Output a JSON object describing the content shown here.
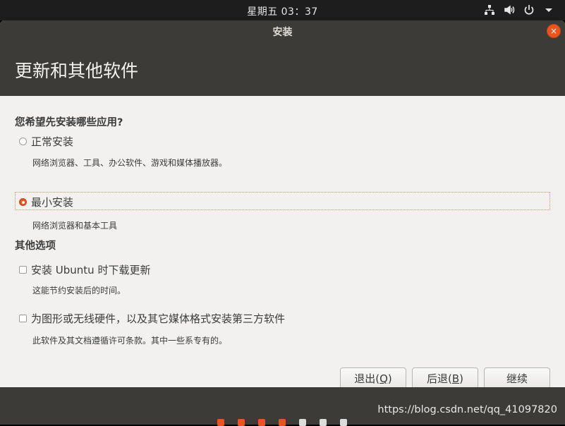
{
  "panel": {
    "clock": "星期五 03：37",
    "tray_icons": [
      "network-icon",
      "volume-icon",
      "power-icon",
      "menu-down-icon"
    ]
  },
  "window": {
    "title": "安装",
    "close_label": "×"
  },
  "header": {
    "title": "更新和其他软件"
  },
  "install_type": {
    "question": "您希望先安装哪些应用?",
    "options": [
      {
        "label": "正常安装",
        "description": "网络浏览器、工具、办公软件、游戏和媒体播放器。",
        "selected": false
      },
      {
        "label": "最小安装",
        "description": "网络浏览器和基本工具",
        "selected": true
      }
    ]
  },
  "other_options": {
    "title": "其他选项",
    "items": [
      {
        "label": "安装 Ubuntu 时下载更新",
        "description": "这能节约安装后的时间。",
        "checked": false
      },
      {
        "label": "为图形或无线硬件，以及其它媒体格式安装第三方软件",
        "description": "此软件及其文档遵循许可条款。其中一些系专有的。",
        "checked": false
      }
    ]
  },
  "buttons": {
    "quit": {
      "prefix": "退出(",
      "mnemonic": "Q",
      "suffix": ")"
    },
    "back": {
      "prefix": "后退(",
      "mnemonic": "B",
      "suffix": ")"
    },
    "continue": "继续"
  },
  "progress": {
    "total_steps": 7,
    "completed_steps": 4,
    "active_color": "#e95420",
    "inactive_color": "#dcdcdc"
  },
  "watermark": "https://blog.csdn.net/qq_41097820",
  "colors": {
    "accent": "#e95420",
    "header_bg": "#3c3b37",
    "window_bg": "#f2f1f0"
  }
}
